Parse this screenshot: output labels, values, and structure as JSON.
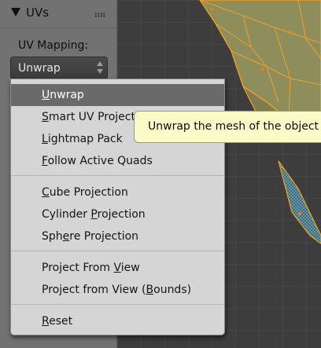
{
  "panel": {
    "title": "UVs",
    "uv_mapping_label": "UV Mapping:",
    "selected_value": "Unwrap"
  },
  "menu": {
    "items": [
      {
        "label": "Unwrap",
        "ul_index": 0,
        "active": true
      },
      {
        "label": "Smart UV Project",
        "ul_index": 0
      },
      {
        "label": "Lightmap Pack",
        "ul_index": 0
      },
      {
        "label": "Follow Active Quads",
        "ul_index": 0
      },
      {
        "label": "Cube Projection",
        "ul_index": 0
      },
      {
        "label": "Cylinder Projection",
        "ul_index": 9
      },
      {
        "label": "Sphere Projection",
        "ul_index": 3
      },
      {
        "label": "Project From View",
        "ul_index": 13
      },
      {
        "label": "Project from View (Bounds)",
        "ul_index": 19
      },
      {
        "label": "Reset",
        "ul_index": 0
      }
    ]
  },
  "tooltip": {
    "text": "Unwrap the mesh of the object being edited"
  },
  "icons": {
    "collapse": "triangle-down-icon",
    "grip": "drag-grip-icon",
    "select_arrows": "up-down-arrows-icon"
  },
  "colors": {
    "panel_bg": "#727272",
    "menu_bg": "#d5d5d5",
    "menu_highlight": "#6a6a6a",
    "tooltip_bg": "#fbfbc7",
    "mesh_fill": "#8e8e5c",
    "mesh_edge": "#f5a020",
    "viewport_bg": "#3d3d3d"
  }
}
